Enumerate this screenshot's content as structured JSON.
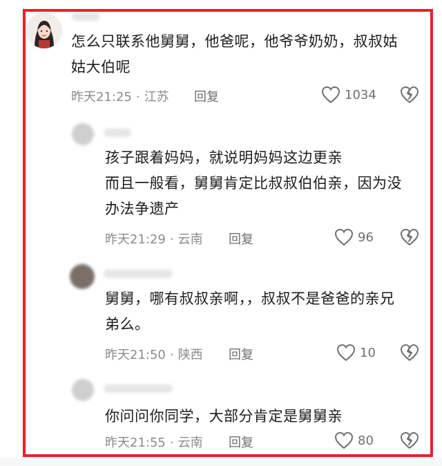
{
  "comments": [
    {
      "lines": [
        "怎么只联系他舅舅，他爸呢，他爷爷奶奶，叔叔姑",
        "姑大伯呢"
      ],
      "time": "昨天21:25",
      "location": "江苏",
      "reply_label": "回复",
      "likes": "1034"
    },
    {
      "lines": [
        "孩子跟着妈妈，就说明妈妈这边更亲",
        "而且一般看，舅舅肯定比叔叔伯伯亲，因为没",
        "办法争遗产"
      ],
      "time": "昨天21:29",
      "location": "云南",
      "reply_label": "回复",
      "likes": "96"
    },
    {
      "lines": [
        "舅舅，哪有叔叔亲啊，，叔叔不是爸爸的亲兄",
        "弟么。"
      ],
      "time": "昨天21:50",
      "location": "陕西",
      "reply_label": "回复",
      "likes": "10"
    },
    {
      "lines": [
        "你问问你同学，大部分肯定是舅舅亲"
      ],
      "time": "昨天21:55",
      "location": "云南",
      "reply_label": "回复",
      "likes": "80"
    }
  ],
  "colors": {
    "frame": "#e8212b",
    "meta": "#8a8a8a",
    "icon": "#6f6f6f"
  },
  "icons": {
    "like": "heart-outline-icon",
    "dislike": "broken-heart-icon"
  }
}
